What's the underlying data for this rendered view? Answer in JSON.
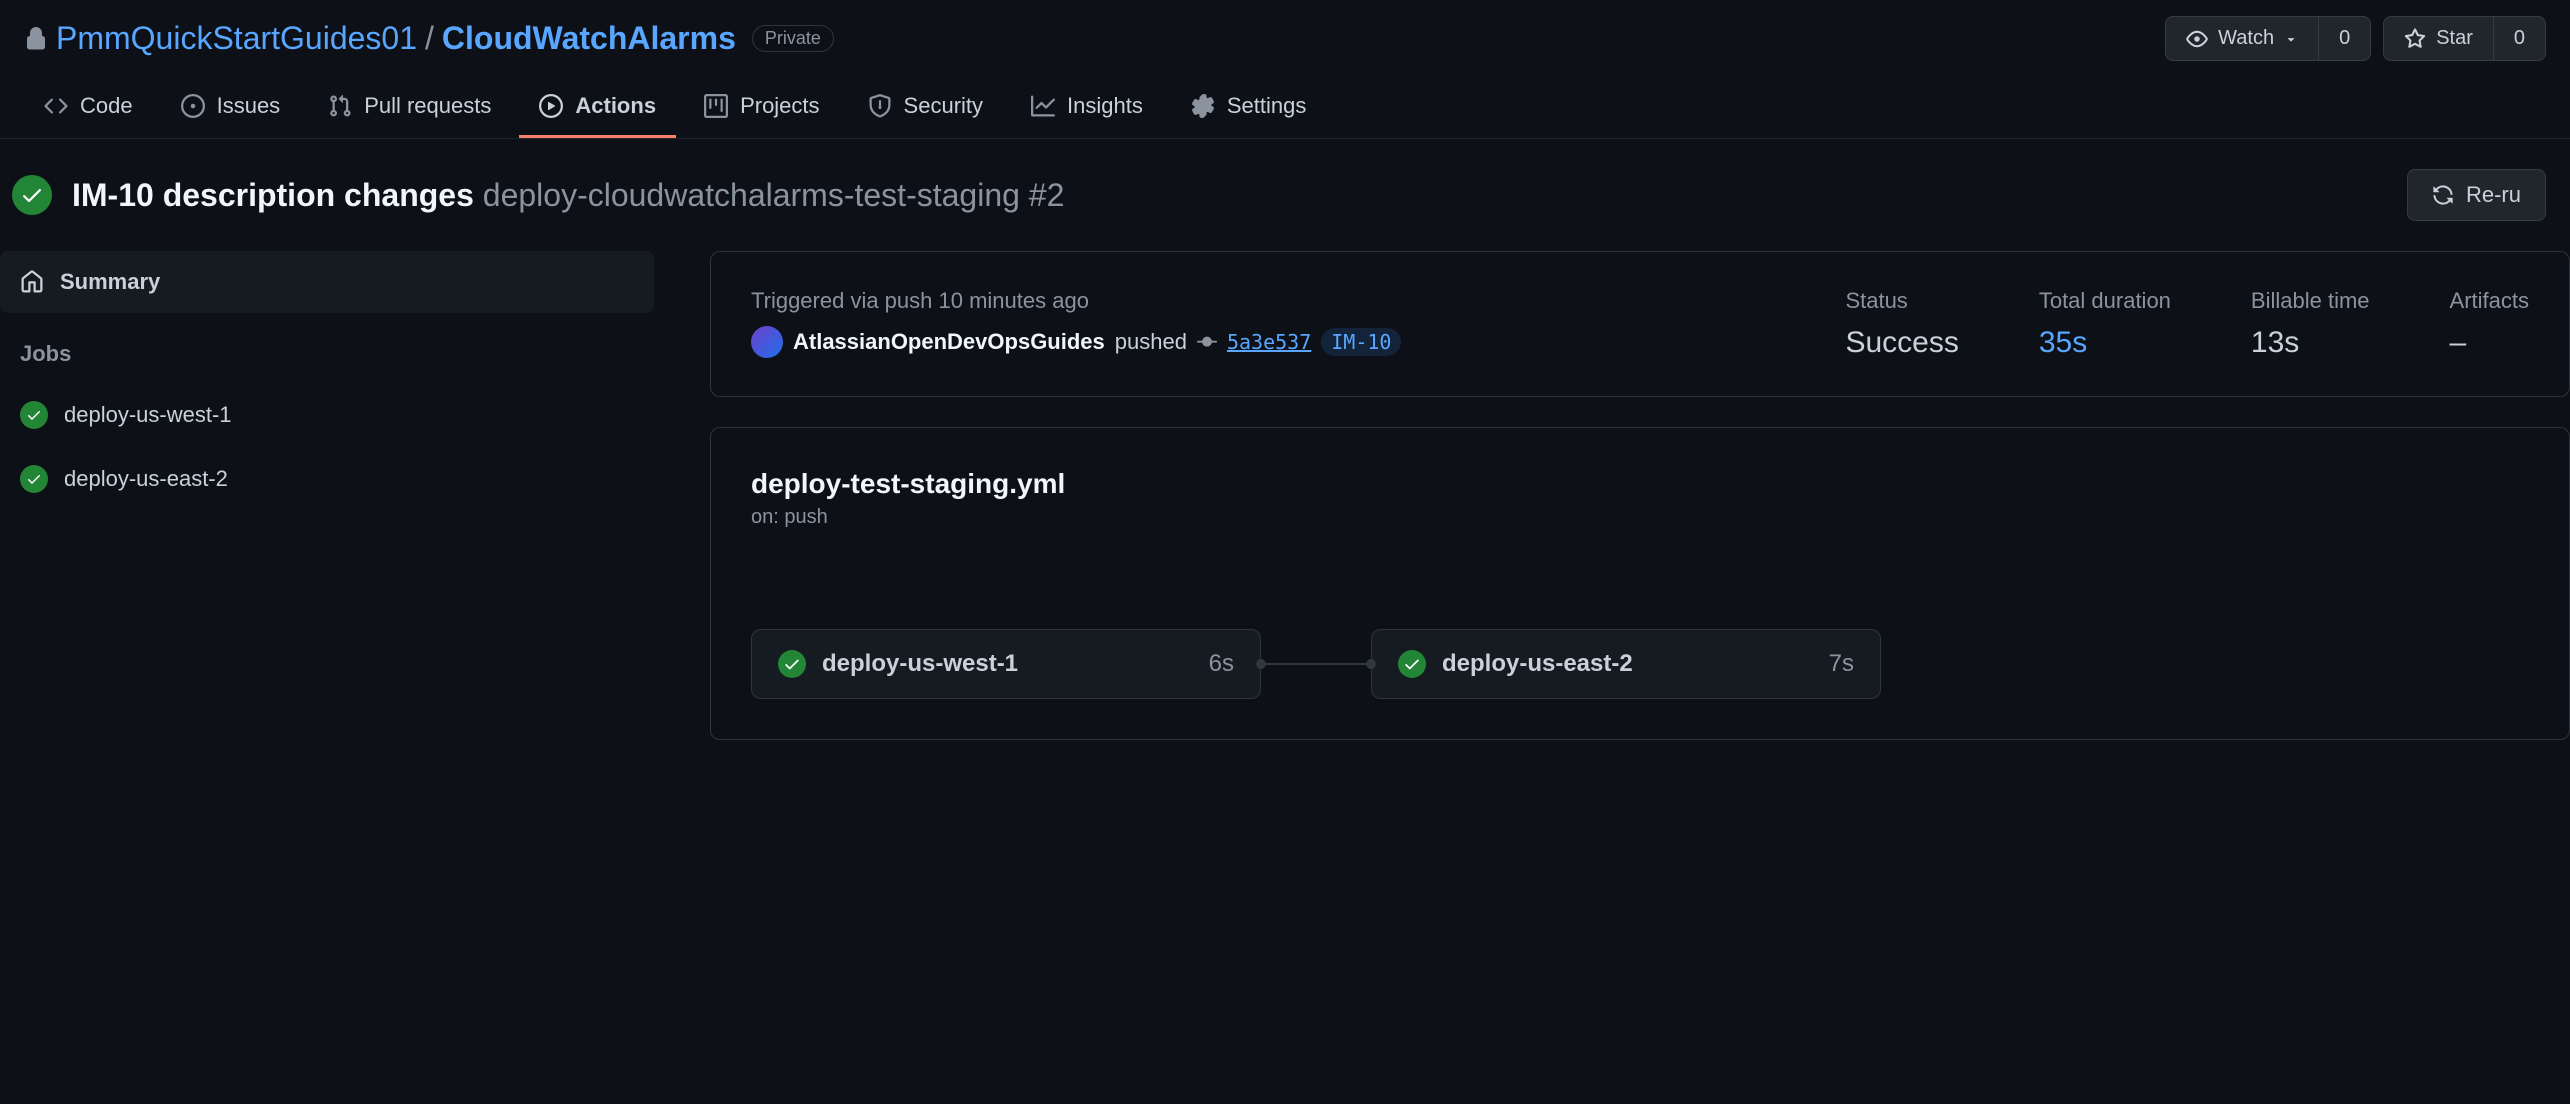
{
  "header": {
    "owner": "PmmQuickStartGuides01",
    "repo": "CloudWatchAlarms",
    "visibility": "Private",
    "watch_label": "Watch",
    "watch_count": "0",
    "star_label": "Star",
    "star_count": "0"
  },
  "tabs": {
    "code": "Code",
    "issues": "Issues",
    "pulls": "Pull requests",
    "actions": "Actions",
    "projects": "Projects",
    "security": "Security",
    "insights": "Insights",
    "settings": "Settings"
  },
  "workflow": {
    "commit_title": "IM-10 description changes",
    "run_title": "deploy-cloudwatchalarms-test-staging #2",
    "rerun_label": "Re-ru"
  },
  "sidebar": {
    "summary": "Summary",
    "jobs_header": "Jobs",
    "jobs": [
      {
        "name": "deploy-us-west-1"
      },
      {
        "name": "deploy-us-east-2"
      }
    ]
  },
  "summary": {
    "trigger_text": "Triggered via push 10 minutes ago",
    "actor": "AtlassianOpenDevOpsGuides",
    "action": "pushed",
    "commit_sha": "5a3e537",
    "issue_ref": "IM-10",
    "status_label": "Status",
    "status_value": "Success",
    "duration_label": "Total duration",
    "duration_value": "35s",
    "billable_label": "Billable time",
    "billable_value": "13s",
    "artifacts_label": "Artifacts",
    "artifacts_value": "–"
  },
  "graph": {
    "file": "deploy-test-staging.yml",
    "on": "on: push",
    "jobs": [
      {
        "name": "deploy-us-west-1",
        "time": "6s"
      },
      {
        "name": "deploy-us-east-2",
        "time": "7s"
      }
    ]
  }
}
